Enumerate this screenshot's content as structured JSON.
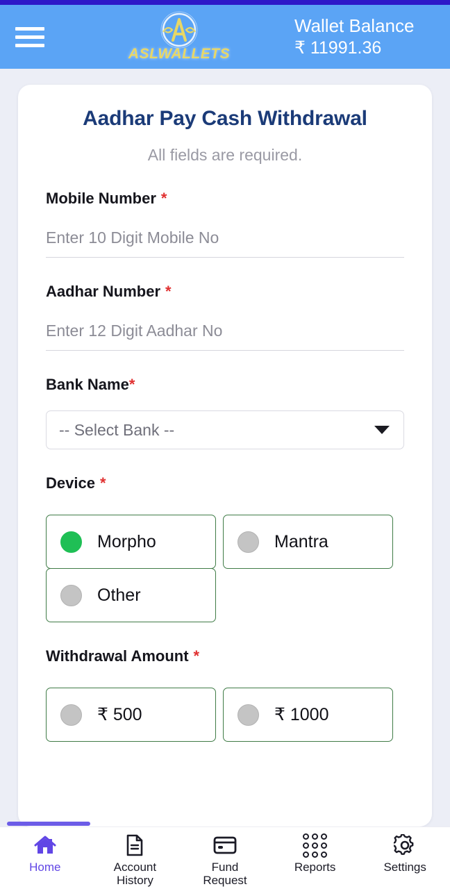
{
  "header": {
    "menu_icon": "hamburger-menu-icon",
    "brand_name": "ASLWALLETS",
    "brand_letter": "A",
    "wallet_label": "Wallet Balance",
    "wallet_amount": "₹ 11991.36",
    "bar_color": "#5ba4f5",
    "strip_color": "#2e18c8"
  },
  "form": {
    "title": "Aadhar Pay Cash Withdrawal",
    "subtitle": "All fields are required.",
    "required_mark": "*",
    "fields": {
      "mobile": {
        "label": "Mobile Number",
        "placeholder": "Enter 10 Digit Mobile No",
        "value": ""
      },
      "aadhar": {
        "label": "Aadhar Number",
        "placeholder": "Enter 12 Digit Aadhar No",
        "value": ""
      },
      "bank": {
        "label": "Bank Name",
        "selected": "-- Select Bank --",
        "caret_icon": "chevron-down-icon"
      },
      "device": {
        "label": "Device",
        "options": [
          {
            "label": "Morpho",
            "selected": true
          },
          {
            "label": "Mantra",
            "selected": false
          },
          {
            "label": "Other",
            "selected": false
          }
        ]
      },
      "amount": {
        "label": "Withdrawal Amount",
        "options": [
          {
            "label": "₹ 500",
            "selected": false
          },
          {
            "label": "₹ 1000",
            "selected": false
          }
        ]
      }
    },
    "colors": {
      "title": "#1b3b78",
      "subtitle": "#9a9aa4",
      "required": "#e03030",
      "radio_selected": "#1fbf55",
      "radio_unselected": "#c4c4c4",
      "option_border": "#3f7b46"
    }
  },
  "bottom_nav": {
    "active_color": "#6146e5",
    "items": [
      {
        "label": "Home",
        "icon": "home-icon",
        "active": true
      },
      {
        "label": "Account\nHistory",
        "label_line1": "Account",
        "label_line2": "History",
        "icon": "document-icon",
        "active": false
      },
      {
        "label": "Fund Request",
        "icon": "credit-card-icon",
        "active": false
      },
      {
        "label": "Reports",
        "icon": "grid-dots-icon",
        "active": false
      },
      {
        "label": "Settings",
        "icon": "gear-icon",
        "active": false
      }
    ]
  }
}
